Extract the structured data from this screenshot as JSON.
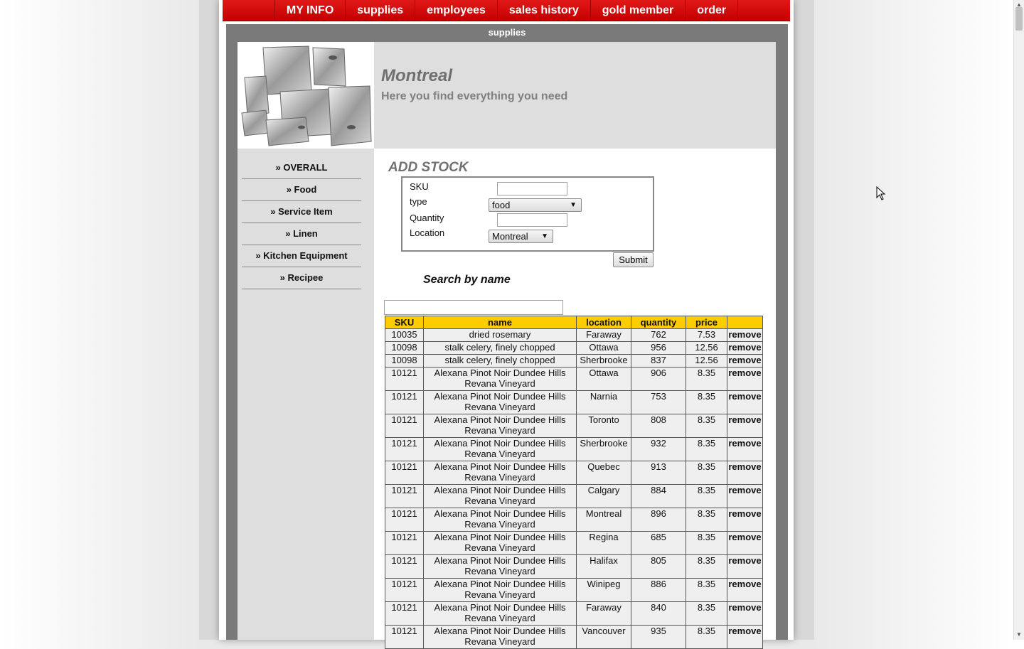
{
  "nav": {
    "items": [
      "MY INFO",
      "supplies",
      "employees",
      "sales history",
      "gold member",
      "order"
    ]
  },
  "section_title": "supplies",
  "header": {
    "city": "Montreal",
    "tagline": "Here you find everything you need",
    "image_icon": "stainless-steel-pans-image"
  },
  "sidebar": {
    "items": [
      "» OVERALL",
      "» Food",
      "» Service Item",
      "» Linen",
      "» Kitchen Equipment",
      "» Recipee"
    ]
  },
  "add_stock": {
    "title": "ADD STOCK",
    "sku_label": "SKU",
    "sku_value": "",
    "type_label": "type",
    "type_value": "food",
    "quantity_label": "Quantity",
    "quantity_value": "",
    "location_label": "Location",
    "location_value": "Montreal",
    "submit_label": "Submit"
  },
  "search": {
    "title": "Search by name",
    "value": ""
  },
  "table": {
    "headers": [
      "SKU",
      "name",
      "location",
      "quantity",
      "price",
      ""
    ],
    "rows": [
      {
        "sku": "10035",
        "name": "dried rosemary",
        "location": "Faraway",
        "quantity": "762",
        "price": "7.53",
        "action": "remove"
      },
      {
        "sku": "10098",
        "name": "stalk celery, finely chopped",
        "location": "Ottawa",
        "quantity": "956",
        "price": "12.56",
        "action": "remove"
      },
      {
        "sku": "10098",
        "name": "stalk celery, finely chopped",
        "location": "Sherbrooke",
        "quantity": "837",
        "price": "12.56",
        "action": "remove"
      },
      {
        "sku": "10121",
        "name": "Alexana Pinot Noir Dundee Hills Revana Vineyard",
        "location": "Ottawa",
        "quantity": "906",
        "price": "8.35",
        "action": "remove"
      },
      {
        "sku": "10121",
        "name": "Alexana Pinot Noir Dundee Hills Revana Vineyard",
        "location": "Narnia",
        "quantity": "753",
        "price": "8.35",
        "action": "remove"
      },
      {
        "sku": "10121",
        "name": "Alexana Pinot Noir Dundee Hills Revana Vineyard",
        "location": "Toronto",
        "quantity": "808",
        "price": "8.35",
        "action": "remove"
      },
      {
        "sku": "10121",
        "name": "Alexana Pinot Noir Dundee Hills Revana Vineyard",
        "location": "Sherbrooke",
        "quantity": "932",
        "price": "8.35",
        "action": "remove"
      },
      {
        "sku": "10121",
        "name": "Alexana Pinot Noir Dundee Hills Revana Vineyard",
        "location": "Quebec",
        "quantity": "913",
        "price": "8.35",
        "action": "remove"
      },
      {
        "sku": "10121",
        "name": "Alexana Pinot Noir Dundee Hills Revana Vineyard",
        "location": "Calgary",
        "quantity": "884",
        "price": "8.35",
        "action": "remove"
      },
      {
        "sku": "10121",
        "name": "Alexana Pinot Noir Dundee Hills Revana Vineyard",
        "location": "Montreal",
        "quantity": "896",
        "price": "8.35",
        "action": "remove"
      },
      {
        "sku": "10121",
        "name": "Alexana Pinot Noir Dundee Hills Revana Vineyard",
        "location": "Regina",
        "quantity": "685",
        "price": "8.35",
        "action": "remove"
      },
      {
        "sku": "10121",
        "name": "Alexana Pinot Noir Dundee Hills Revana Vineyard",
        "location": "Halifax",
        "quantity": "805",
        "price": "8.35",
        "action": "remove"
      },
      {
        "sku": "10121",
        "name": "Alexana Pinot Noir Dundee Hills Revana Vineyard",
        "location": "Winipeg",
        "quantity": "886",
        "price": "8.35",
        "action": "remove"
      },
      {
        "sku": "10121",
        "name": "Alexana Pinot Noir Dundee Hills Revana Vineyard",
        "location": "Faraway",
        "quantity": "840",
        "price": "8.35",
        "action": "remove"
      },
      {
        "sku": "10121",
        "name": "Alexana Pinot Noir Dundee Hills Revana Vineyard",
        "location": "Vancouver",
        "quantity": "935",
        "price": "8.35",
        "action": "remove"
      }
    ]
  },
  "colors": {
    "nav_red": "#d00000",
    "table_header": "#ffcc00",
    "frame_gray": "#7a7a7a"
  }
}
